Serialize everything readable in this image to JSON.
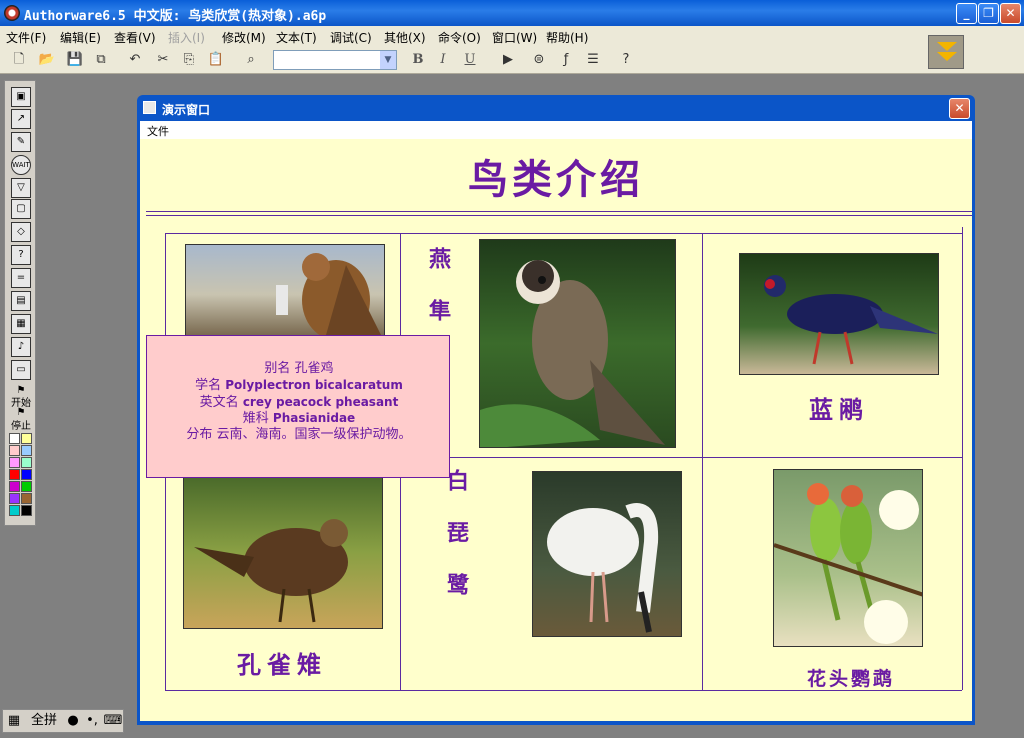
{
  "app": {
    "title": "Authorware6.5 中文版: 鸟类欣赏(热对象).a6p",
    "window_controls": {
      "minimize": "_",
      "restore": "❐",
      "close": "✕"
    }
  },
  "menu": [
    "文件(F)",
    "编辑(E)",
    "查看(V)",
    "插入(I)",
    "修改(M)",
    "文本(T)",
    "调试(C)",
    "其他(X)",
    "命令(O)",
    "窗口(W)",
    "帮助(H)"
  ],
  "menu_disabled": [
    "插入(I)"
  ],
  "toolbar": {
    "icons": [
      "new-icon",
      "open-icon",
      "save-all-icon",
      "import-icon",
      "undo-icon",
      "cut-icon",
      "copy-icon",
      "paste-icon",
      "find-icon",
      "bold-icon",
      "italic-icon",
      "underline-icon",
      "run-icon",
      "control-panel-icon",
      "functions-icon",
      "variables-icon",
      "knowledge-objects-icon",
      "help-pointer-icon"
    ],
    "bold": "B",
    "italic": "I",
    "underline": "U",
    "style_value": ""
  },
  "palette": {
    "start_label": "开始",
    "stop_label": "停止",
    "swatch_colors": [
      "#ffffff",
      "#ffff99",
      "#ffcccc",
      "#99ccff",
      "#ff99ff",
      "#99ffcc",
      "#ff0000",
      "#0000ff",
      "#cc00cc",
      "#00cc00",
      "#9933ff",
      "#996633",
      "#00cccc",
      "#000000"
    ]
  },
  "presentation": {
    "window_title": "演示窗口",
    "menu_file": "文件",
    "close": "✕",
    "page_title": "鸟类介绍",
    "birds": {
      "swallow_falcon": "燕隼",
      "blue_pheasant": "蓝鹇",
      "peacock_pheasant": "孔雀雉",
      "spoonbill": "白琵鹭",
      "parakeet": "花头鹦鹉"
    },
    "popup": {
      "alias": "别名 孔雀鸡",
      "sci_prefix": "学名 ",
      "sci_name": "Polyplectron bicalcaratum",
      "en_prefix": "英文名 ",
      "en_name": "crey peacock pheasant",
      "family_prefix": "雉科 ",
      "family_name": "Phasianidae",
      "distribution": "分布 云南、海南。国家一级保护动物。"
    }
  },
  "ime": {
    "mode": "全拼",
    "period": "•,"
  }
}
